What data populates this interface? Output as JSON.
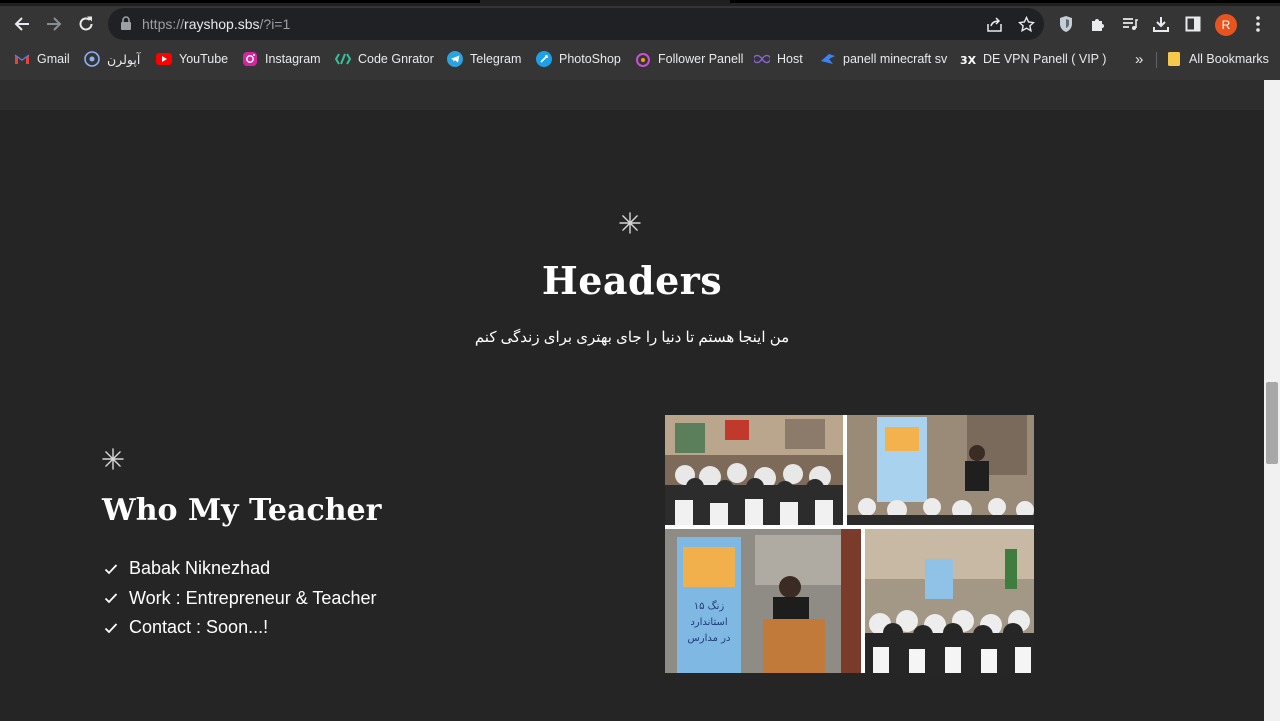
{
  "browser": {
    "url_prefix": "https://",
    "url_domain": "rayshop.sbs",
    "url_path": "/?i=1",
    "profile_initial": "R",
    "accent_color": "#e8541e",
    "bookmarks": [
      {
        "label": "Gmail",
        "icon": "gmail-icon"
      },
      {
        "label": "آپولرن",
        "icon": "apollorn-icon"
      },
      {
        "label": "YouTube",
        "icon": "youtube-icon"
      },
      {
        "label": "Instagram",
        "icon": "instagram-icon"
      },
      {
        "label": "Code Gnrator",
        "icon": "code-generator-icon"
      },
      {
        "label": "Telegram",
        "icon": "telegram-icon"
      },
      {
        "label": "PhotoShop",
        "icon": "photoshop-icon"
      },
      {
        "label": "Follower Panell",
        "icon": "follower-panel-icon"
      },
      {
        "label": "Host",
        "icon": "host-infinity-icon"
      },
      {
        "label": "panell minecraft sv",
        "icon": "minecraft-panel-icon"
      },
      {
        "label": "DE VPN Panell ( VIP )",
        "icon": "3x-vpn-icon"
      }
    ],
    "more_bookmarks": "»",
    "all_bookmarks_label": "All Bookmarks"
  },
  "page": {
    "hero": {
      "title": "Headers",
      "subtitle": "من اینجا هستم تا دنیا را جای بهتری برای زندگی کنم"
    },
    "teacher": {
      "title": "Who My Teacher",
      "facts": [
        "Babak Niknezhad",
        "Work : Entrepreneur & Teacher",
        "Contact : Soon...!"
      ]
    },
    "collage_banner_text": [
      "زنگ ۱۵",
      "استاندارد",
      "در مدارس"
    ]
  }
}
